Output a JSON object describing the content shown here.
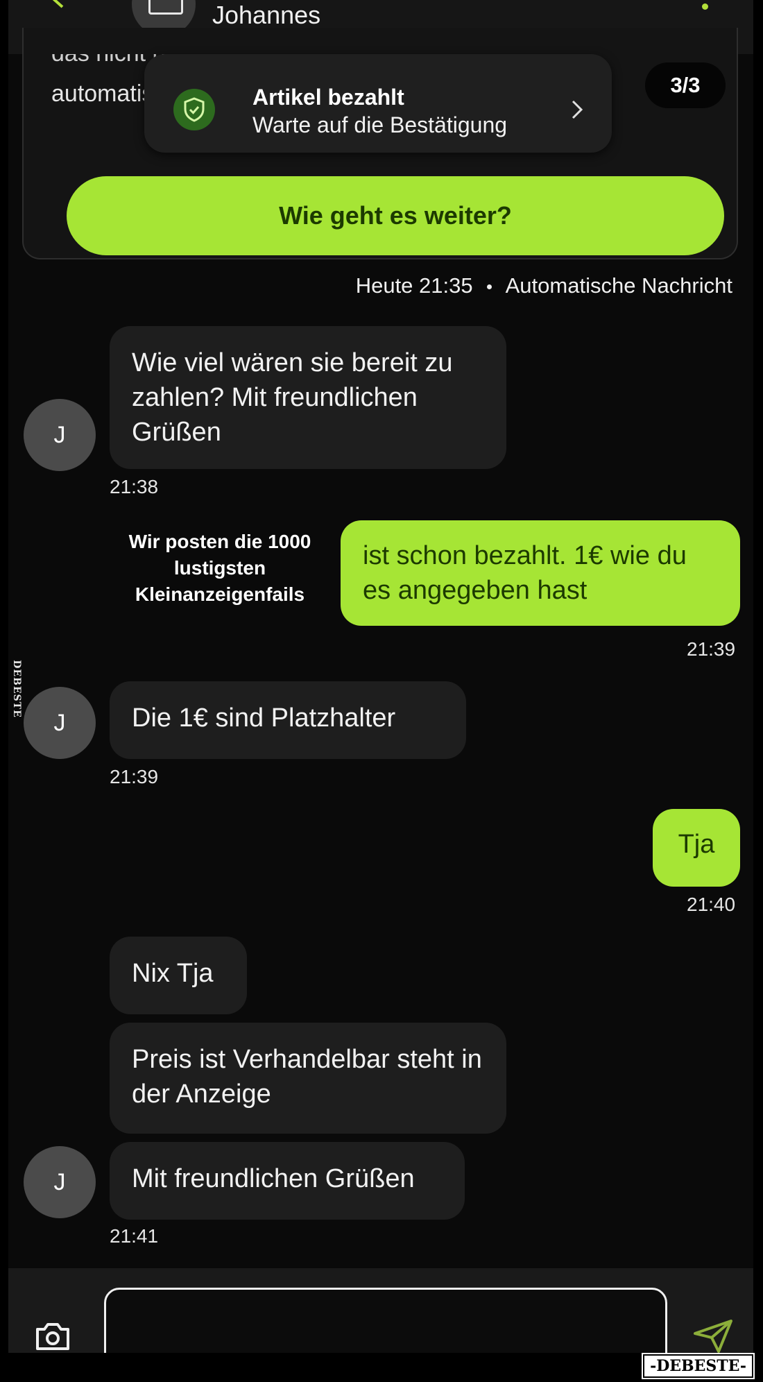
{
  "header": {
    "contact_name": "Johannes"
  },
  "card": {
    "cut_text": "das nicht passieren, erhältst du dein Geld",
    "partial_text": "automatisch",
    "counter": "3/3",
    "popup_title": "Artikel bezahlt",
    "popup_subtitle": "Warte auf die Bestätigung",
    "cta_label": "Wie geht es weiter?"
  },
  "system_line": {
    "time": "Heute 21:35",
    "label": "Automatische Nachricht"
  },
  "messages": [
    {
      "side": "in",
      "text": "Wie viel wären sie bereit zu zahlen? Mit freundlichen Grüßen",
      "time": "21:38"
    },
    {
      "side": "out",
      "text": "ist schon bezahlt. 1€ wie du es angegeben hast",
      "time": "21:39"
    },
    {
      "side": "in",
      "text": "Die 1€ sind Platzhalter",
      "time": "21:39"
    },
    {
      "side": "out",
      "text": "Tja",
      "time": "21:40"
    },
    {
      "side": "in",
      "text": "Nix Tja"
    },
    {
      "side": "in",
      "text": "Preis ist Verhandelbar steht in der Anzeige"
    },
    {
      "side": "in",
      "text": "Mit freundlichen Grüßen",
      "time": "21:41"
    }
  ],
  "avatar_initial": "J",
  "promo_text": "Wir posten die 1000 lustigsten Kleinanzeigenfails",
  "watermark_side": "DEBESTE",
  "watermark_corner": "-DEBESTE-",
  "colors": {
    "accent": "#a6e535",
    "accent_text": "#1c3a00",
    "incoming_bubble": "#1e1e1e",
    "background": "#0a0a0a"
  }
}
